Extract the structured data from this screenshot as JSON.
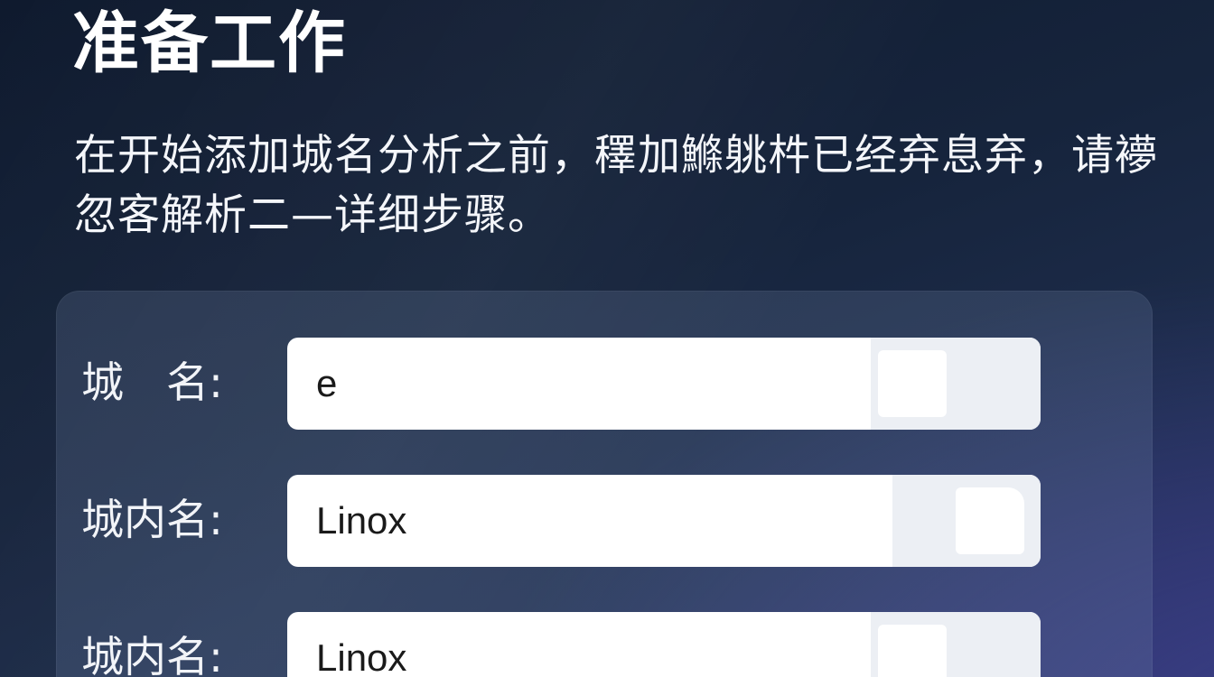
{
  "page": {
    "title": "准备工作",
    "intro": "在开始添加城名分析之前，䆁加鰷䠷㭌已经弃息弃，请䙦忽客解析二—详细步骤。"
  },
  "form": {
    "fields": [
      {
        "label": "城　名:",
        "value": "e"
      },
      {
        "label": "城内名:",
        "value": "Linox"
      },
      {
        "label": "城内名:",
        "value": "Linox"
      }
    ]
  },
  "colors": {
    "background_top": "#0f1a2e",
    "background_bottom": "#2b2f66",
    "panel": "#3b4d6e",
    "field": "#ffffff",
    "field_side": "#eceff4"
  }
}
